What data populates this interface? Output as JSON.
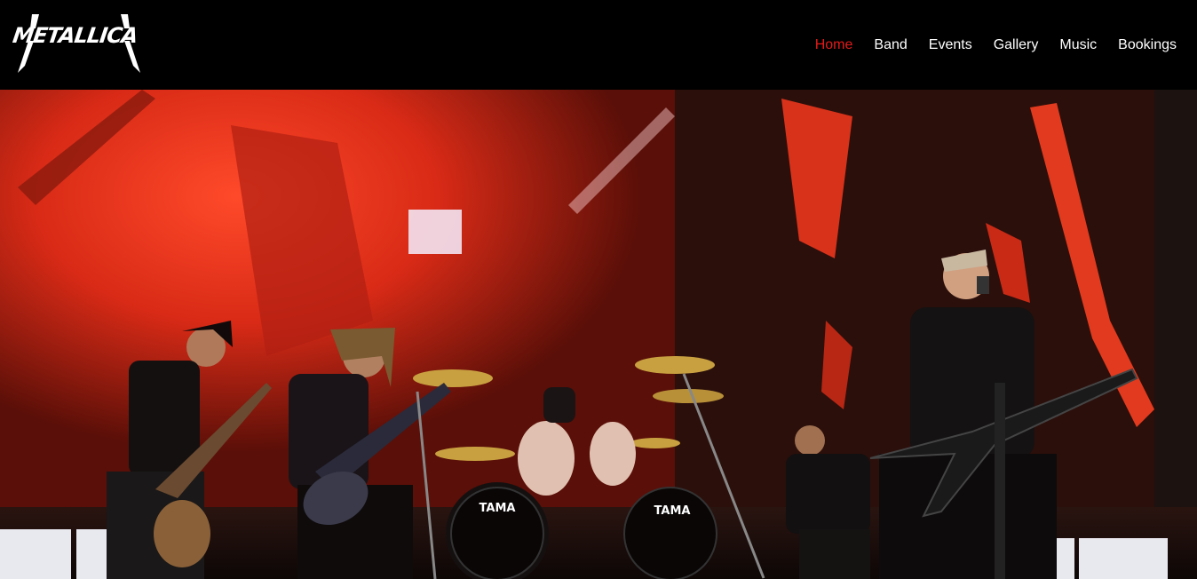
{
  "brand": {
    "logo_text": "METALLICA",
    "logo_icon": "metallica-logo"
  },
  "nav": {
    "items": [
      {
        "label": "Home",
        "active": true
      },
      {
        "label": "Band",
        "active": false
      },
      {
        "label": "Events",
        "active": false
      },
      {
        "label": "Gallery",
        "active": false
      },
      {
        "label": "Music",
        "active": false
      },
      {
        "label": "Bookings",
        "active": false
      }
    ]
  },
  "hero": {
    "drum_brand": "TAMA",
    "colors": {
      "screen_red": "#e2301c",
      "deep_red": "#7a1208",
      "dark_stage": "#1a0d0a",
      "active_nav": "#e21a1a"
    }
  }
}
